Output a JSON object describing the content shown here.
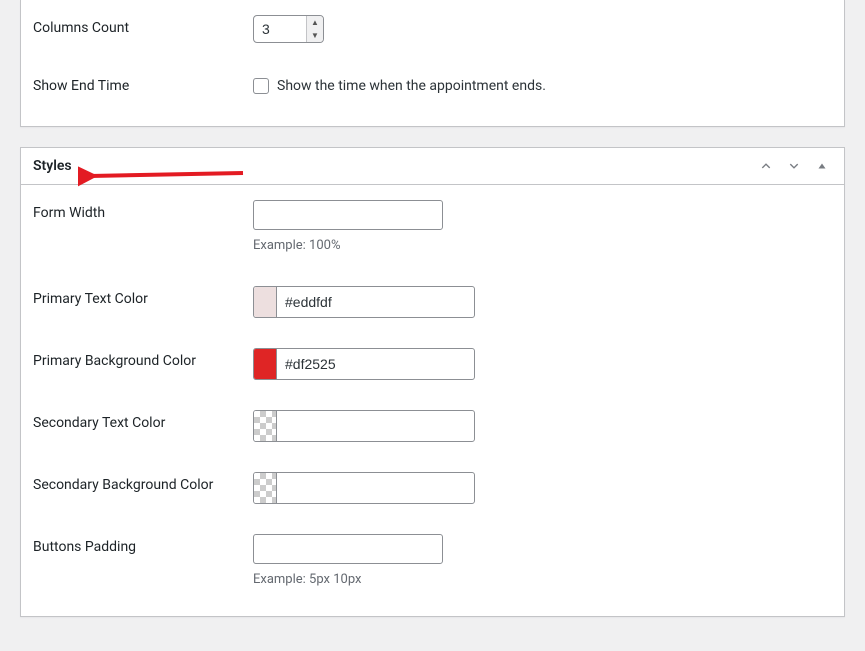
{
  "top_section": {
    "columns_count_label": "Columns Count",
    "columns_count_value": "3",
    "show_end_time_label": "Show End Time",
    "show_end_time_desc": "Show the time when the appointment ends."
  },
  "styles_section": {
    "title": "Styles",
    "form_width_label": "Form Width",
    "form_width_value": "",
    "form_width_hint": "Example: 100%",
    "primary_text_color_label": "Primary Text Color",
    "primary_text_color_value": "#eddfdf",
    "primary_text_color_swatch": "#eddfdf",
    "primary_bg_color_label": "Primary Background Color",
    "primary_bg_color_value": "#df2525",
    "primary_bg_color_swatch": "#df2525",
    "secondary_text_color_label": "Secondary Text Color",
    "secondary_text_color_value": "",
    "secondary_bg_color_label": "Secondary Background Color",
    "secondary_bg_color_value": "",
    "buttons_padding_label": "Buttons Padding",
    "buttons_padding_value": "",
    "buttons_padding_hint": "Example: 5px 10px"
  }
}
